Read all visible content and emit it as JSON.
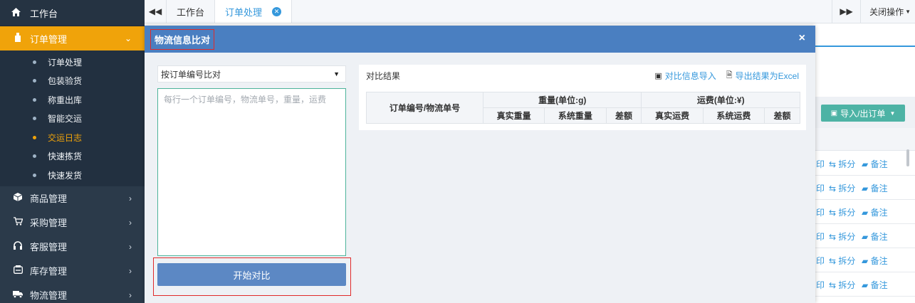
{
  "sidebar": {
    "home": {
      "label": "工作台",
      "icon": "home-icon"
    },
    "groups": [
      {
        "label": "订单管理",
        "icon": "order-icon",
        "active": true
      },
      {
        "label": "商品管理",
        "icon": "product-icon"
      },
      {
        "label": "采购管理",
        "icon": "cart-icon"
      },
      {
        "label": "客服管理",
        "icon": "headset-icon"
      },
      {
        "label": "库存管理",
        "icon": "inventory-icon"
      },
      {
        "label": "物流管理",
        "icon": "truck-icon"
      }
    ],
    "order_sub": [
      "订单处理",
      "包装验货",
      "称重出库",
      "智能交运",
      "交运日志",
      "快速拣货",
      "快速发货"
    ],
    "current_sub_index": 4
  },
  "tabs": {
    "back_icon": "double-left-icon",
    "items": [
      {
        "label": "工作台"
      },
      {
        "label": "订单处理",
        "active": true
      }
    ],
    "forward_icon": "double-right-icon",
    "close_ops": "关闭操作"
  },
  "background": {
    "export_button": "导入/出订单",
    "row_actions": {
      "split": "拆分",
      "note": "备注",
      "print_fragment": "印"
    }
  },
  "modal": {
    "title": "物流信息比对",
    "close": "×",
    "mode_select": {
      "value": "按订单编号比对"
    },
    "input": {
      "placeholder": "每行一个订单编号，物流单号，重量，运费",
      "value": ""
    },
    "start_button": "开始对比",
    "result": {
      "title": "对比结果",
      "import_action": "对比信息导入",
      "export_action": "导出结果为Excel",
      "table": {
        "col_key": "订单编号/物流单号",
        "group_weight": "重量(单位:g)",
        "group_fee": "运费(单位:¥)",
        "weight_cols": [
          "真实重量",
          "系统重量",
          "差额"
        ],
        "fee_cols": [
          "真实运费",
          "系统运费",
          "差额"
        ]
      }
    }
  },
  "colors": {
    "sidebar_bg": "#2b3a4a",
    "active_orange": "#f0a30a",
    "modal_header": "#4a7fc1",
    "primary_button": "#5c88c4",
    "link_blue": "#3598dc",
    "highlight_red": "#e02a2a",
    "input_border": "#4db39a"
  }
}
